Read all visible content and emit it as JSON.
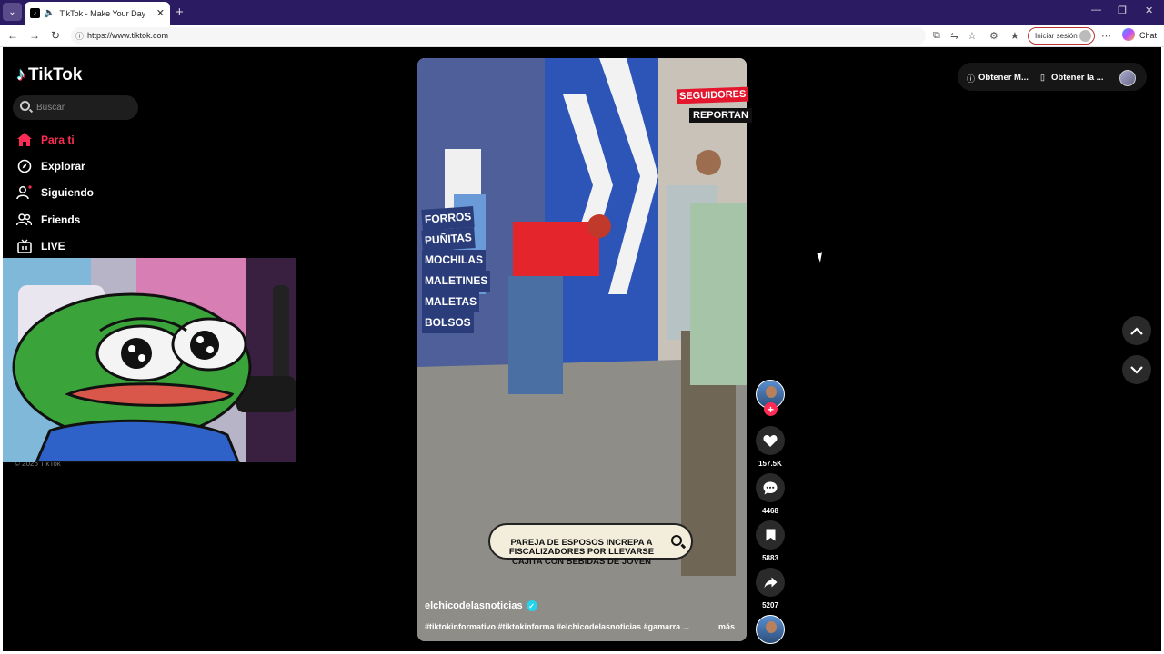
{
  "browser": {
    "tab_title": "TikTok - Make Your Day",
    "url": "https://www.tiktok.com",
    "signin_label": "Iniciar sesión",
    "chat_label": "Chat"
  },
  "sidebar": {
    "brand": "TikTok",
    "search_placeholder": "Buscar",
    "items": [
      {
        "label": "Para ti",
        "icon": "home-icon",
        "active": true
      },
      {
        "label": "Explorar",
        "icon": "compass-icon"
      },
      {
        "label": "Siguiendo",
        "icon": "following-icon"
      },
      {
        "label": "Friends",
        "icon": "friends-icon"
      },
      {
        "label": "LIVE",
        "icon": "live-icon"
      }
    ],
    "copyright": "© 2026 TikTok"
  },
  "header": {
    "get_coins_label": "Obtener M...",
    "get_app_label": "Obtener la ..."
  },
  "video": {
    "badge_top": "SEGUIDORES",
    "badge_bottom": "REPORTAN",
    "caption": "PAREJA DE ESPOSOS INCREPA A\nFISCALIZADORES POR LLEVARSE\nCAJITA CON BEBIDAS DE JOVEN",
    "author": "elchicodelasnoticias",
    "description": "#tiktokinformativo #tiktokinforma #elchicodelasnoticias #gamarra ...",
    "more_label": "más",
    "scene_text": {
      "line1": "FORROS",
      "line2": "PUÑITAS",
      "line3": "MOCHILAS",
      "line4": "MALETINES",
      "line5": "MALETAS",
      "line6": "BOLSOS"
    }
  },
  "actions": {
    "likes": "157.5K",
    "comments": "4468",
    "saves": "5883",
    "shares": "5207"
  },
  "colors": {
    "accent": "#fe2c55",
    "titlebar": "#2b1b63",
    "pepe_green": "#3aa43a"
  }
}
